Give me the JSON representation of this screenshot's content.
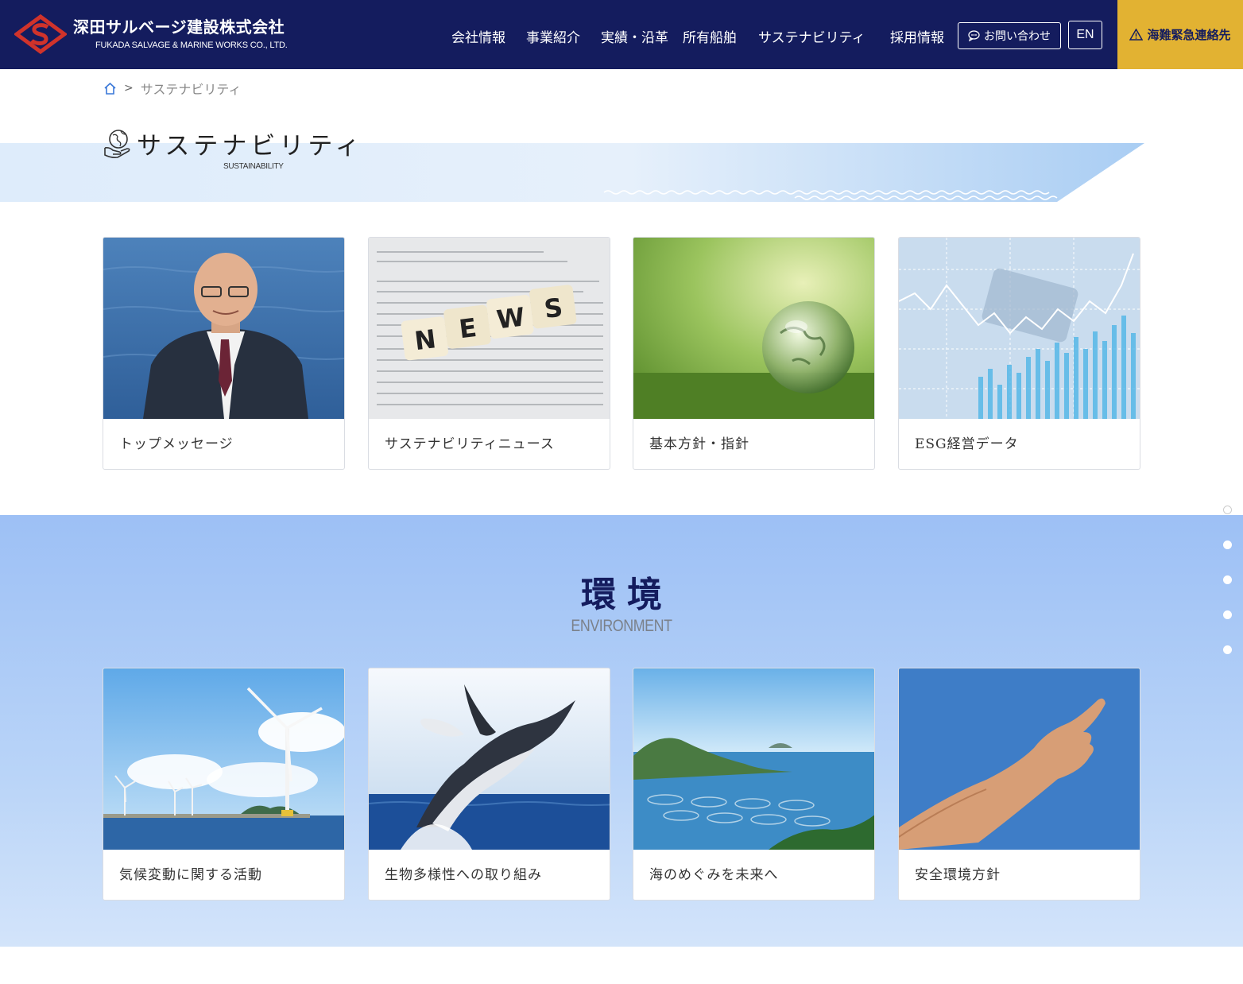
{
  "header": {
    "company_jp": "深田サルベージ建設株式会社",
    "company_en": "FUKADA SALVAGE & MARINE WORKS CO., LTD.",
    "nav": [
      "会社情報",
      "事業紹介",
      "実績・沿革",
      "所有船舶",
      "サステナビリティ",
      "採用情報"
    ],
    "contact_label": "お問い合わせ",
    "lang_label": "EN",
    "emergency_label": "海難緊急連絡先",
    "colors": {
      "navy": "#141c5e",
      "gold": "#e2b232"
    }
  },
  "breadcrumb": {
    "current": "サステナビリティ"
  },
  "page": {
    "title": "サステナビリティ",
    "subtitle": "SUSTAINABILITY"
  },
  "top_cards": [
    {
      "label": "トップメッセージ"
    },
    {
      "label": "サステナビリティニュース"
    },
    {
      "label": "基本方針・指針"
    },
    {
      "label": "ESG経営データ"
    }
  ],
  "environment": {
    "title": "環境",
    "subtitle": "ENVIRONMENT",
    "cards": [
      {
        "label": "気候変動に関する活動"
      },
      {
        "label": "生物多様性への取り組み"
      },
      {
        "label": "海のめぐみを未来へ"
      },
      {
        "label": "安全環境方針"
      }
    ]
  },
  "news_tiles": [
    "N",
    "E",
    "W",
    "S"
  ]
}
